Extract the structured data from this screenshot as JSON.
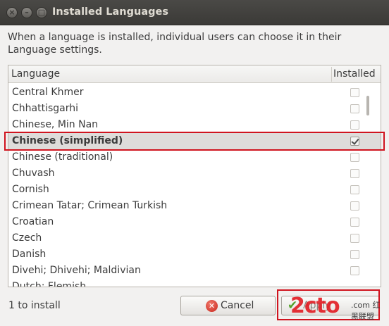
{
  "window": {
    "title": "Installed Languages",
    "buttons": {
      "close": "×",
      "minimize": "–",
      "maximize": "□"
    }
  },
  "description": "When a language is installed, individual users can choose it in their Language settings.",
  "list": {
    "header_language": "Language",
    "header_installed": "Installed",
    "rows": [
      {
        "name": "Central Khmer",
        "installed": false
      },
      {
        "name": "Chhattisgarhi",
        "installed": false
      },
      {
        "name": "Chinese, Min Nan",
        "installed": false
      },
      {
        "name": "Chinese (simplified)",
        "installed": true,
        "selected": true
      },
      {
        "name": "Chinese (traditional)",
        "installed": false
      },
      {
        "name": "Chuvash",
        "installed": false
      },
      {
        "name": "Cornish",
        "installed": false
      },
      {
        "name": "Crimean Tatar; Crimean Turkish",
        "installed": false
      },
      {
        "name": "Croatian",
        "installed": false
      },
      {
        "name": "Czech",
        "installed": false
      },
      {
        "name": "Danish",
        "installed": false
      },
      {
        "name": "Divehi; Dhivehi; Maldivian",
        "installed": false
      },
      {
        "name": "Dutch; Flemish",
        "installed": false,
        "partial": true
      }
    ]
  },
  "footer": {
    "status": "1 to install",
    "cancel_label": "Cancel",
    "apply_label": "Apply"
  },
  "watermark": {
    "logo": "2cto",
    "sub": ".com 红黑联盟"
  },
  "colors": {
    "titlebar": "#3c3b37",
    "highlight": "#d0141f",
    "selected_row": "#dedcda",
    "background": "#f2f1f0"
  }
}
